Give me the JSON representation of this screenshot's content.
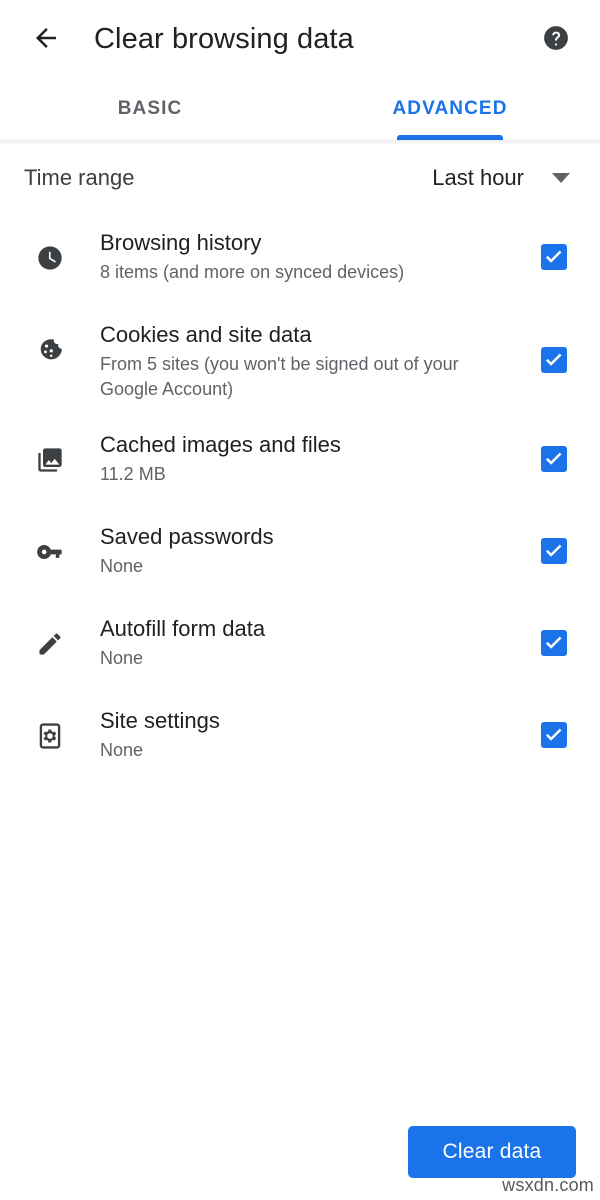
{
  "appbar": {
    "back_icon": "back-arrow-icon",
    "title": "Clear browsing data",
    "help_icon": "help-circle-icon"
  },
  "tabs": [
    {
      "label": "BASIC",
      "active": false
    },
    {
      "label": "ADVANCED",
      "active": true
    }
  ],
  "time_range": {
    "label": "Time range",
    "value": "Last hour",
    "dropdown_icon": "chevron-down-icon"
  },
  "items": [
    {
      "icon": "clock-icon",
      "title": "Browsing history",
      "subtitle": "8 items (and more on synced devices)",
      "checked": true
    },
    {
      "icon": "cookie-icon",
      "title": "Cookies and site data",
      "subtitle": "From 5 sites (you won't be signed out of your Google Account)",
      "checked": true
    },
    {
      "icon": "photo-library-icon",
      "title": "Cached images and files",
      "subtitle": "11.2 MB",
      "checked": true
    },
    {
      "icon": "key-icon",
      "title": "Saved passwords",
      "subtitle": "None",
      "checked": true
    },
    {
      "icon": "pencil-icon",
      "title": "Autofill form data",
      "subtitle": "None",
      "checked": true
    },
    {
      "icon": "site-settings-icon",
      "title": "Site settings",
      "subtitle": "None",
      "checked": true
    }
  ],
  "footer": {
    "clear_label": "Clear data"
  },
  "watermark": "wsxdn.com",
  "colors": {
    "accent": "#1a73e8",
    "title_text": "#202124",
    "secondary_text": "#5f6368",
    "icon_dark": "#3c4043",
    "background": "#ffffff"
  }
}
